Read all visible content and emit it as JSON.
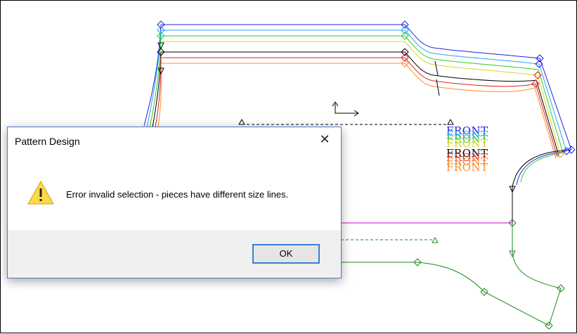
{
  "app": {
    "window": "Pattern Design"
  },
  "canvas": {
    "labels": [
      "FRONT",
      "FRONT",
      "FRONT",
      "FRONT",
      "FRONT",
      "FRONT",
      "FRONT",
      "FRONT"
    ],
    "colors": {
      "blue": "#1f22e0",
      "sky": "#2aa0ff",
      "green": "#2ad02a",
      "yellow": "#e0d020",
      "black": "#000000",
      "red": "#e02020",
      "orange": "#ff8a2a",
      "magenta": "#d000d0",
      "darkgreen": "#1a8a1a"
    }
  },
  "dialog": {
    "title": "Pattern Design",
    "close_glyph": "✕",
    "icon": "warning-icon",
    "message": "Error invalid selection - pieces have different size lines.",
    "ok_label": "OK"
  }
}
